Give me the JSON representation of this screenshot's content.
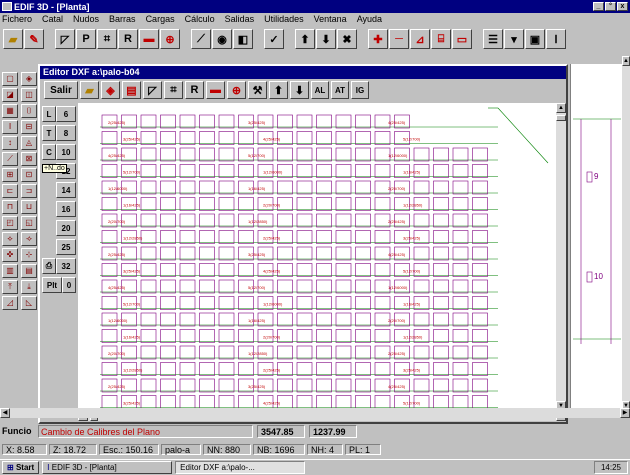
{
  "window": {
    "title": "EDIF 3D - [Planta]",
    "controls": [
      "_",
      "°",
      "x"
    ]
  },
  "menu": [
    "Fichero",
    "Catal",
    "Nudos",
    "Barras",
    "Cargas",
    "Cálculo",
    "Salidas",
    "Utilidades",
    "Ventana",
    "Ayuda"
  ],
  "toolbar": {
    "letter_P": "P",
    "letter_R": "R"
  },
  "editor": {
    "title": "Editor DXF a:\\palo-b04",
    "salir": "Salir",
    "letter_R": "R",
    "btn_al": "AL",
    "btn_at": "AT",
    "btn_ig": "IG"
  },
  "levels": [
    {
      "a": "L",
      "b": "6"
    },
    {
      "a": "T",
      "b": "8"
    },
    {
      "a": "C",
      "b": "10"
    },
    {
      "a": "",
      "b": "12"
    },
    {
      "a": "",
      "b": "14"
    },
    {
      "a": "",
      "b": "16"
    },
    {
      "a": "",
      "b": "20"
    },
    {
      "a": "",
      "b": "25"
    },
    {
      "a": "",
      "b": "32"
    },
    {
      "a": "Plt",
      "b": "0"
    }
  ],
  "tooltip": "+N..do",
  "right_labels": [
    "9",
    "10"
  ],
  "func": {
    "label": "Funcio",
    "message": "Cambio de Calibres del Plano",
    "x": "3547.85",
    "y": "1237.99"
  },
  "status": {
    "x": "X: 8.58",
    "z": "Z: 18.72",
    "esc": "Esc.: 150.16",
    "file": "palo-a",
    "nn": "NN: 880",
    "nb": "NB: 1696",
    "nh": "NH: 4",
    "pl": "PL: 1"
  },
  "taskbar": {
    "start": "Start",
    "task1": "EDIF 3D - [Planta]",
    "task2": "Editor DXF a:\\palo-...",
    "clock": "14:25"
  },
  "drawing_labels": [
    "2(25/425)",
    "3(25/425)",
    "4(25/425)",
    "5(12/700)",
    "1(12/6000)",
    "1(16/425)",
    "2(20/700)",
    "1(12/2850)"
  ],
  "colors": {
    "title": "#000080",
    "accent_red": "#c00000",
    "grid": "#800080",
    "green": "#008000"
  }
}
